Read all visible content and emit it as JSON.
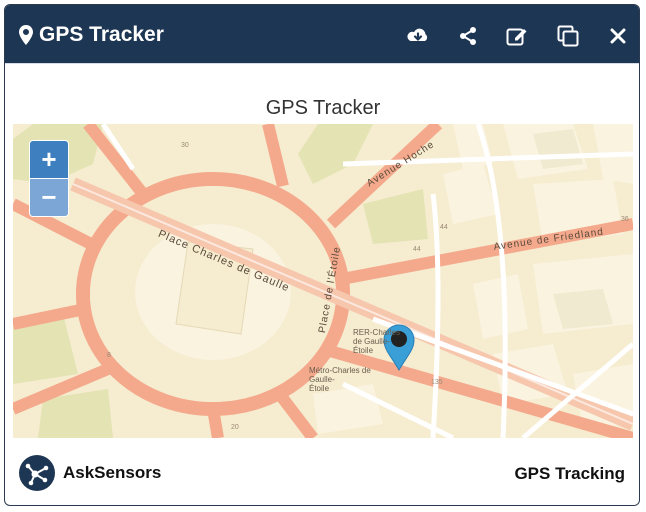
{
  "header": {
    "title": "GPS Tracker",
    "icons": [
      "map-marker-icon",
      "cloud-download-icon",
      "share-icon",
      "edit-icon",
      "copy-icon",
      "close-icon"
    ]
  },
  "map": {
    "title": "GPS Tracker",
    "zoom_in_label": "+",
    "zoom_out_label": "−",
    "street_labels": {
      "place_charles_de_gaulle": "Place Charles de Gaulle",
      "avenue_hoche": "Avenue Hoche",
      "avenue_de_friedland": "Avenue de Friedland",
      "place_de_l_etoile": "Place de l'Étoile",
      "rer_line1": "RER-Charles",
      "rer_line2": "de Gaulle-",
      "rer_line3": "Étoile",
      "metro_line1": "Métro-Charles de",
      "metro_line2": "Gaulle-",
      "metro_line3": "Étoile",
      "num_44a": "44",
      "num_44b": "44",
      "num_36": "36",
      "num_135": "135",
      "num_8": "8",
      "num_20": "20",
      "num_30": "30"
    },
    "colors": {
      "land": "#f6ecd0",
      "park": "#e6e4b4",
      "road": "#f4a98c",
      "building": "#f8f2e0",
      "minor_road": "#ffffff",
      "marker": "#3a9fd6"
    }
  },
  "footer": {
    "brand": "AskSensors",
    "right_label": "GPS Tracking"
  },
  "colors": {
    "header_bg": "#1d3654",
    "zoom_in_bg": "#3e7fc0",
    "zoom_out_bg": "#7ca6d6"
  }
}
